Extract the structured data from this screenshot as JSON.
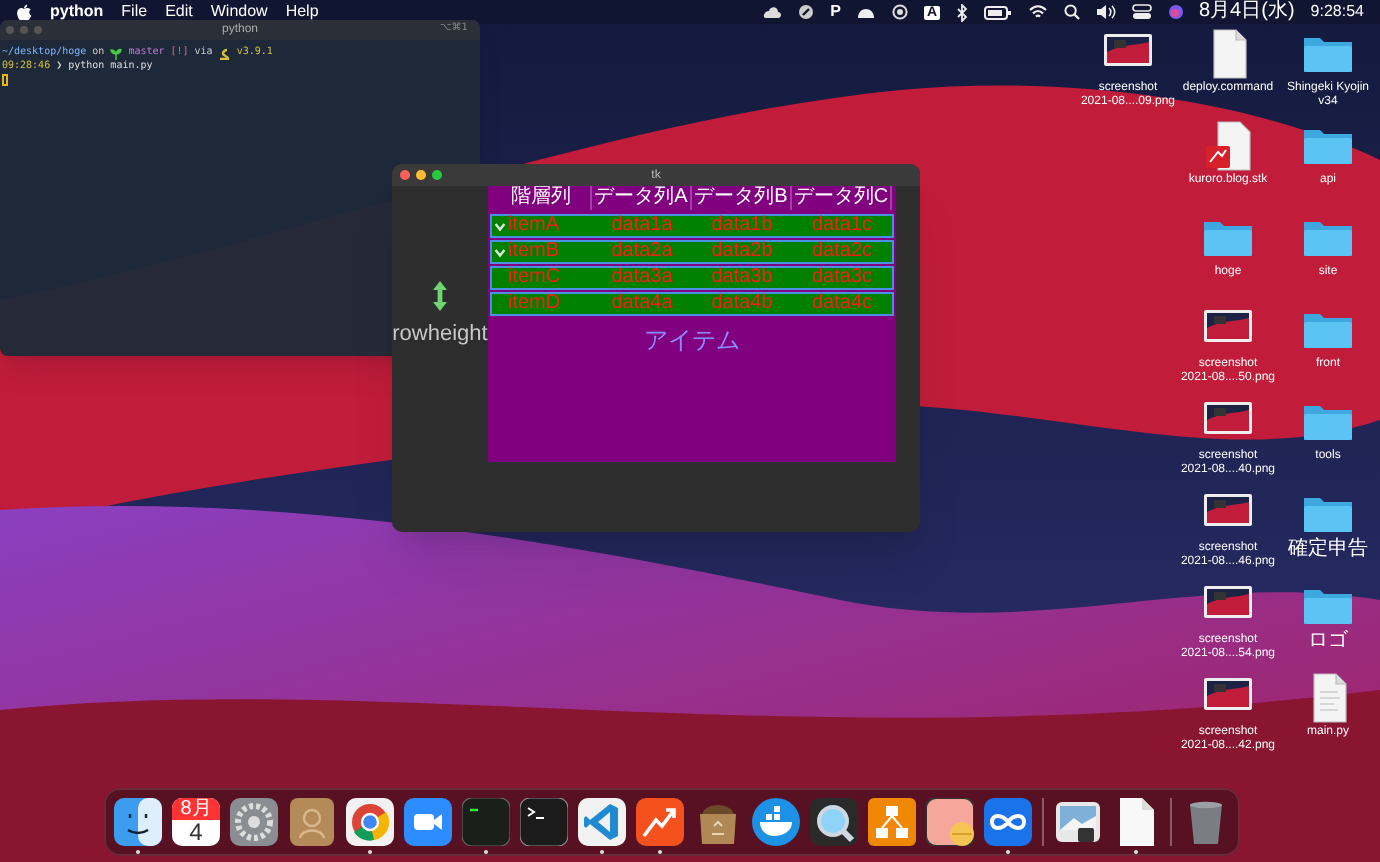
{
  "menu_bar": {
    "app_name": "python",
    "menus": [
      "File",
      "Edit",
      "Window",
      "Help"
    ],
    "status_glyphs": [
      "P",
      "A"
    ],
    "date": "8月4日(水)",
    "time": "9:28:54"
  },
  "terminal": {
    "title": "python",
    "shortcut": "⌥⌘1",
    "prompt": {
      "path": "~/desktop/hoge",
      "on": "on",
      "branch": "master",
      "status": "[!]",
      "via": "via",
      "version": "v3.9.1"
    },
    "command_line": {
      "time": "09:28:46",
      "arrow": "❯",
      "command": "python main.py"
    }
  },
  "tk_window": {
    "title": "tk",
    "side_label": "rowheight",
    "columns": [
      "階層列",
      "データ列A",
      "データ列B",
      "データ列C"
    ],
    "rows": [
      {
        "cells": [
          "itemA",
          "data1a",
          "data1b",
          "data1c"
        ],
        "expanded": true
      },
      {
        "cells": [
          "itemB",
          "data2a",
          "data2b",
          "data2c"
        ],
        "expanded": true
      },
      {
        "cells": [
          "itemC",
          "data3a",
          "data3b",
          "data3c"
        ],
        "expanded": false
      },
      {
        "cells": [
          "itemD",
          "data4a",
          "data4b",
          "data4c"
        ],
        "expanded": false
      }
    ],
    "caption": "アイテム"
  },
  "desktop_columns": [
    [
      {
        "kind": "screenshot",
        "lines": [
          "screenshot",
          "2021-08....09.png"
        ]
      }
    ],
    [
      {
        "kind": "shell",
        "lines": [
          "deploy.command"
        ]
      },
      {
        "kind": "stk",
        "lines": [
          "kuroro.blog.stk"
        ]
      },
      {
        "kind": "folder",
        "lines": [
          "hoge"
        ]
      },
      {
        "kind": "screenshot",
        "lines": [
          "screenshot",
          "2021-08....50.png"
        ]
      },
      {
        "kind": "screenshot",
        "lines": [
          "screenshot",
          "2021-08....40.png"
        ]
      },
      {
        "kind": "screenshot",
        "lines": [
          "screenshot",
          "2021-08....46.png"
        ]
      },
      {
        "kind": "screenshot",
        "lines": [
          "screenshot",
          "2021-08....54.png"
        ]
      },
      {
        "kind": "screenshot",
        "lines": [
          "screenshot",
          "2021-08....42.png"
        ]
      }
    ],
    [
      {
        "kind": "folder",
        "lines": [
          "Shingeki Kyojin",
          "v34"
        ]
      },
      {
        "kind": "folder",
        "lines": [
          "api"
        ]
      },
      {
        "kind": "folder",
        "lines": [
          "site"
        ]
      },
      {
        "kind": "folder",
        "lines": [
          "front"
        ]
      },
      {
        "kind": "folder",
        "lines": [
          "tools"
        ]
      },
      {
        "kind": "folder",
        "lines": [
          "確定申告"
        ]
      },
      {
        "kind": "folder",
        "lines": [
          "ロゴ"
        ]
      },
      {
        "kind": "python",
        "lines": [
          "main.py"
        ]
      }
    ]
  ],
  "dock": [
    {
      "kind": "finder",
      "running": true
    },
    {
      "kind": "calendar",
      "running": false,
      "month": "8月",
      "day": "4"
    },
    {
      "kind": "settings",
      "running": false
    },
    {
      "kind": "contacts",
      "running": false
    },
    {
      "kind": "browser",
      "running": true
    },
    {
      "kind": "video",
      "running": false
    },
    {
      "kind": "iterm",
      "running": true
    },
    {
      "kind": "terminal",
      "running": false
    },
    {
      "kind": "editor",
      "running": true
    },
    {
      "kind": "trend",
      "running": true
    },
    {
      "kind": "archive",
      "running": false
    },
    {
      "kind": "whale",
      "running": false
    },
    {
      "kind": "player",
      "running": false
    },
    {
      "kind": "flowchart",
      "running": false
    },
    {
      "kind": "pill",
      "running": false
    },
    {
      "kind": "infinity",
      "running": true
    },
    {
      "kind": "divider"
    },
    {
      "kind": "photo",
      "running": false
    },
    {
      "kind": "document",
      "running": true
    },
    {
      "kind": "divider"
    },
    {
      "kind": "trash",
      "running": false
    }
  ]
}
